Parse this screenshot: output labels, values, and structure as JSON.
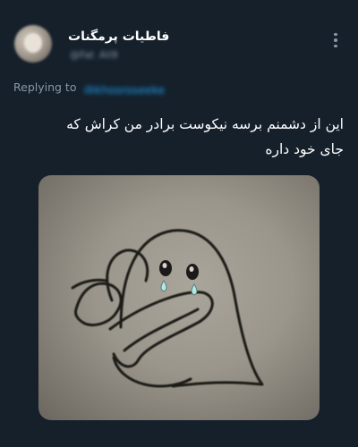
{
  "tweet": {
    "display_name": "فاطیات پرمگنات",
    "handle": "@Fat_Ali9",
    "replying_prefix": "Replying to",
    "replying_to": "@khosroseeke",
    "text_lines": [
      "این از دشمنم برسه نیکوست برادر من کراش که",
      "جای خود داره"
    ],
    "media": {
      "subject": "hand-drawn-crying-ghost-hug-sketch"
    }
  },
  "colors": {
    "background": "#15202b",
    "secondary_text": "#8899a6",
    "link": "#1da1f2",
    "primary_text": "#ffffff"
  },
  "icons": {
    "more": "more-vertical-icon"
  }
}
